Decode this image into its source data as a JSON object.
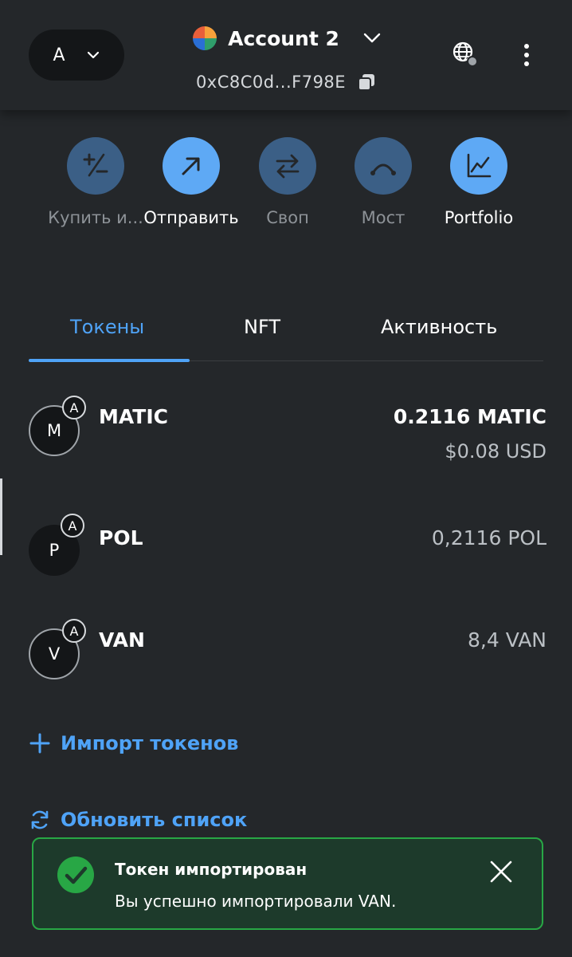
{
  "header": {
    "network_letter": "A",
    "account_name": "Account 2",
    "address": "0xC8C0d...F798E"
  },
  "actions": [
    {
      "label": "Купить и...",
      "icon": "plus-minus-icon",
      "state": "disabled"
    },
    {
      "label": "Отправить",
      "icon": "arrow-up-right-icon",
      "state": "enabled"
    },
    {
      "label": "Своп",
      "icon": "swap-arrows-icon",
      "state": "disabled"
    },
    {
      "label": "Мост",
      "icon": "bridge-icon",
      "state": "disabled"
    },
    {
      "label": "Portfolio",
      "icon": "chart-line-icon",
      "state": "enabled"
    }
  ],
  "tabs": [
    {
      "label": "Токены",
      "active": true
    },
    {
      "label": "NFT",
      "active": false
    },
    {
      "label": "Активность",
      "active": false
    }
  ],
  "tokens": [
    {
      "letter": "M",
      "badge": "A",
      "name": "MATIC",
      "amount": "0.2116 MATIC",
      "fiat": "$0.08 USD"
    },
    {
      "letter": "P",
      "badge": "A",
      "name": "POL",
      "amount": "0,2116 POL"
    },
    {
      "letter": "V",
      "badge": "A",
      "name": "VAN",
      "amount": "8,4 VAN"
    }
  ],
  "links": {
    "import": "Импорт токенов",
    "refresh": "Обновить список"
  },
  "toast": {
    "title": "Токен импортирован",
    "message": "Вы успешно импортировали VAN."
  },
  "colors": {
    "background": "#24272a",
    "accent": "#4fa3f7",
    "success": "#28a745"
  }
}
